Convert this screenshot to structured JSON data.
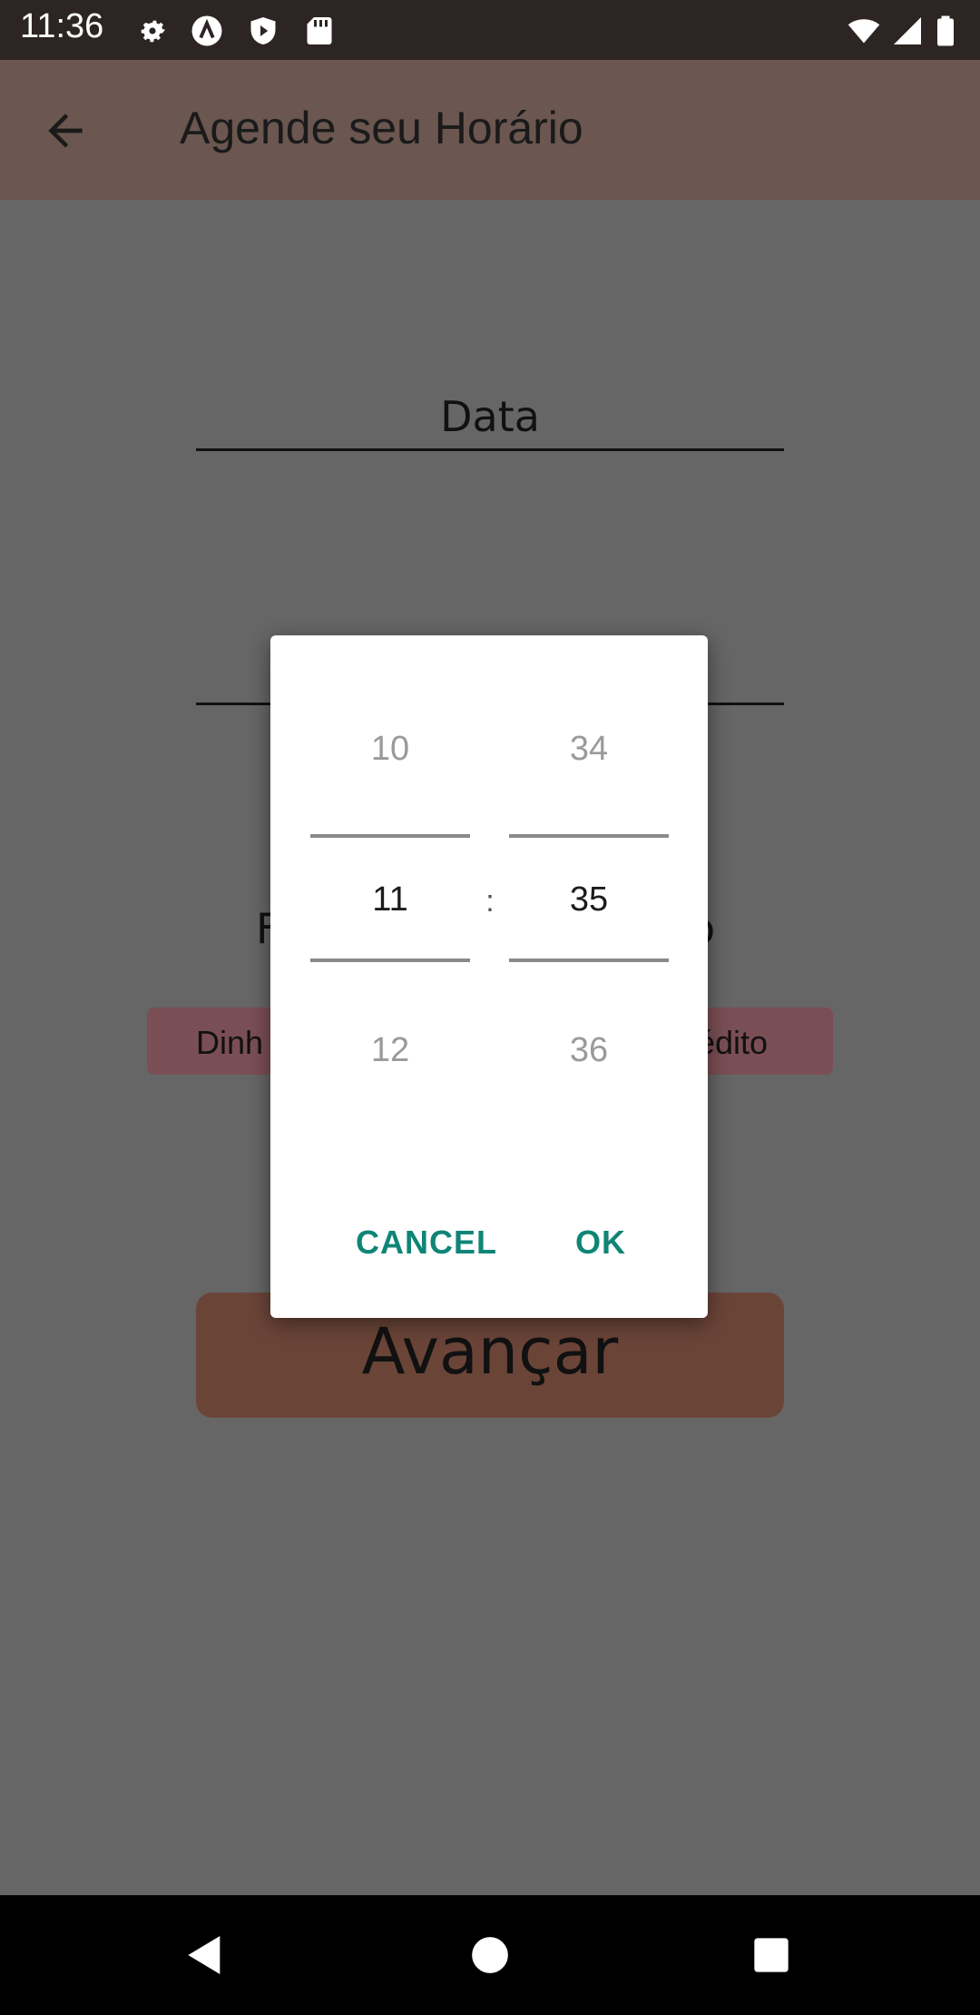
{
  "status_bar": {
    "time": "11:36",
    "left_icons": [
      "gear-icon",
      "a-letter-icon",
      "shield-play-icon",
      "sd-card-icon"
    ],
    "right_icons": [
      "wifi-icon",
      "signal-icon",
      "battery-icon"
    ]
  },
  "app_bar": {
    "title": "Agende seu Horário",
    "back_icon": "arrow-back-icon",
    "color": "#6b5650"
  },
  "form": {
    "date_label": "Data",
    "payment_label_left": "F",
    "payment_label_right": "o",
    "payment_option_left": "Dinh",
    "payment_option_right": "édito",
    "advance_button": "Avançar"
  },
  "time_picker": {
    "hours": {
      "above": "10",
      "selected": "11",
      "below": "12"
    },
    "minutes": {
      "above": "34",
      "selected": "35",
      "below": "36"
    },
    "separator": ":",
    "cancel_label": "CANCEL",
    "ok_label": "OK",
    "accent_color": "#108577"
  },
  "nav_bar": {
    "back_icon": "nav-back-icon",
    "home_icon": "nav-home-icon",
    "recents_icon": "nav-recents-icon"
  }
}
